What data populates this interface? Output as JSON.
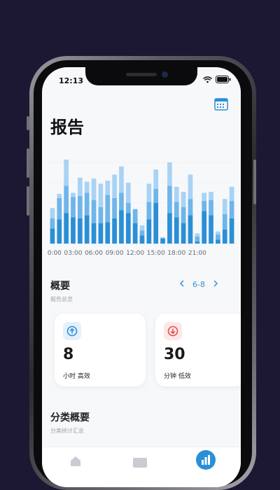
{
  "status": {
    "time": "12:13"
  },
  "page": {
    "title": "报告"
  },
  "chart_data": {
    "type": "bar",
    "stacked": true,
    "x_tick_labels": [
      "00:00",
      "03:00",
      "06:00",
      "09:00",
      "12:00",
      "15:00",
      "18:00",
      "21:00"
    ],
    "series": [
      {
        "values": [
          15,
          24,
          30,
          26,
          25,
          28,
          20,
          20,
          21,
          25,
          33,
          30,
          20,
          8,
          24,
          40,
          5,
          30,
          26,
          20,
          28,
          2,
          32,
          28,
          4,
          14,
          25
        ]
      },
      {
        "values": [
          10,
          21,
          27,
          20,
          22,
          22,
          23,
          16,
          27,
          20,
          17,
          10,
          14,
          5,
          17,
          14,
          1,
          27,
          15,
          16,
          16,
          5,
          10,
          15,
          5,
          15,
          17
        ]
      },
      {
        "values": [
          10,
          4,
          40,
          4,
          18,
          11,
          21,
          23,
          14,
          23,
          26,
          20,
          0,
          5,
          18,
          19,
          0,
          23,
          15,
          15,
          24,
          3,
          8,
          8,
          3,
          15,
          14
        ]
      }
    ],
    "colors": [
      "#2a8fd6",
      "#6eb5ea",
      "#a9d3f4"
    ],
    "ylim": [
      0,
      80
    ],
    "grid": true
  },
  "overview": {
    "title": "概要",
    "subtitle": "报告总览",
    "range_label": "6-8",
    "cards": [
      {
        "value": "8",
        "label": "小时 高效",
        "icon": "arrow-up-circle-icon",
        "icon_bg": "#e4f1fb",
        "icon_color": "#2a8fd6"
      },
      {
        "value": "30",
        "label": "分钟 低效",
        "icon": "arrow-down-circle-icon",
        "icon_bg": "#fde8e8",
        "icon_color": "#e05252"
      }
    ]
  },
  "category": {
    "title": "分类概要",
    "subtitle": "分类统计汇总"
  },
  "tabbar": {
    "items": [
      {
        "icon": "home-icon"
      },
      {
        "icon": "stats-icon"
      },
      {
        "icon": "report-icon",
        "active": true
      }
    ]
  },
  "colors": {
    "accent": "#2a8fd6",
    "background": "#1c1833"
  }
}
